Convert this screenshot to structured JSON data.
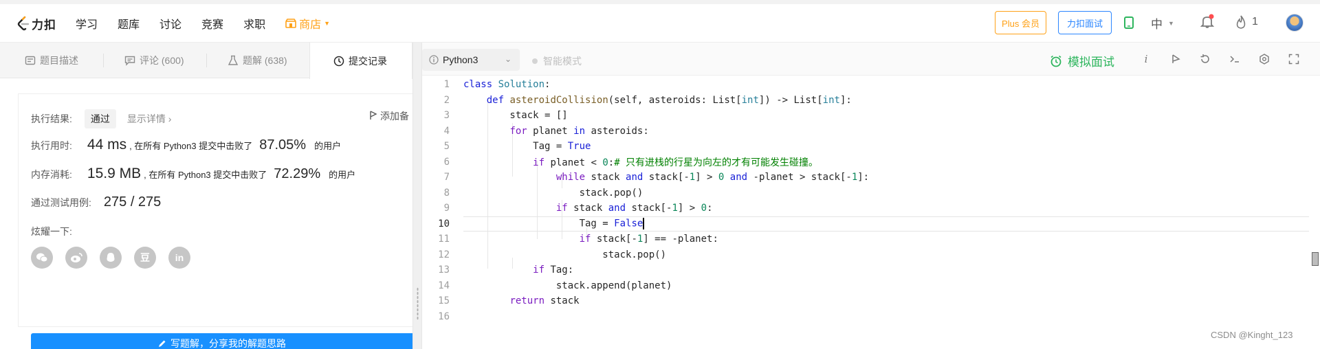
{
  "nav": {
    "logo_text": "力扣",
    "links": [
      "学习",
      "题库",
      "讨论",
      "竞赛",
      "求职"
    ],
    "shop_label": "商店",
    "plus_label": "Plus 会员",
    "mock_interview_label": "力扣面试",
    "language_label": "中",
    "fire_count": "1",
    "brand_color": "#ffa116",
    "accent_color": "#2a85ff"
  },
  "tabs": [
    {
      "label": "题目描述",
      "icon": "description-icon"
    },
    {
      "label": "评论 (600)",
      "icon": "comment-icon"
    },
    {
      "label": "题解 (638)",
      "icon": "flask-icon"
    },
    {
      "label": "提交记录",
      "icon": "clock-icon"
    }
  ],
  "result": {
    "status_label": "执行结果:",
    "status_value": "通过",
    "detail_link": "显示详情",
    "add_note": "添加备",
    "runtime_label": "执行用时:",
    "runtime_value": "44 ms",
    "runtime_beats_text": ", 在所有 Python3 提交中击败了",
    "runtime_percent": "87.05%",
    "users_suffix": "的用户",
    "memory_label": "内存消耗:",
    "memory_value": "15.9 MB",
    "memory_beats_text": ", 在所有 Python3 提交中击败了",
    "memory_percent": "72.29%",
    "tests_label": "通过测试用例:",
    "tests_value": "275 / 275",
    "share_label": "炫耀一下:",
    "share_icons": [
      "wechat-icon",
      "weibo-icon",
      "qq-icon",
      "douban-icon",
      "linkedin-icon"
    ],
    "douban_glyph": "豆",
    "linkedin_glyph": "in",
    "write_solution_label": "写题解，分享我的解题思路"
  },
  "editor": {
    "language": "Python3",
    "smart_mode_label": "智能模式",
    "mock_label": "模拟面试",
    "current_line": 10,
    "line_numbers": [
      "1",
      "2",
      "3",
      "4",
      "5",
      "6",
      "7",
      "8",
      "9",
      "10",
      "11",
      "12",
      "13",
      "14",
      "15",
      "16"
    ]
  },
  "watermark": "CSDN @Kinght_123"
}
